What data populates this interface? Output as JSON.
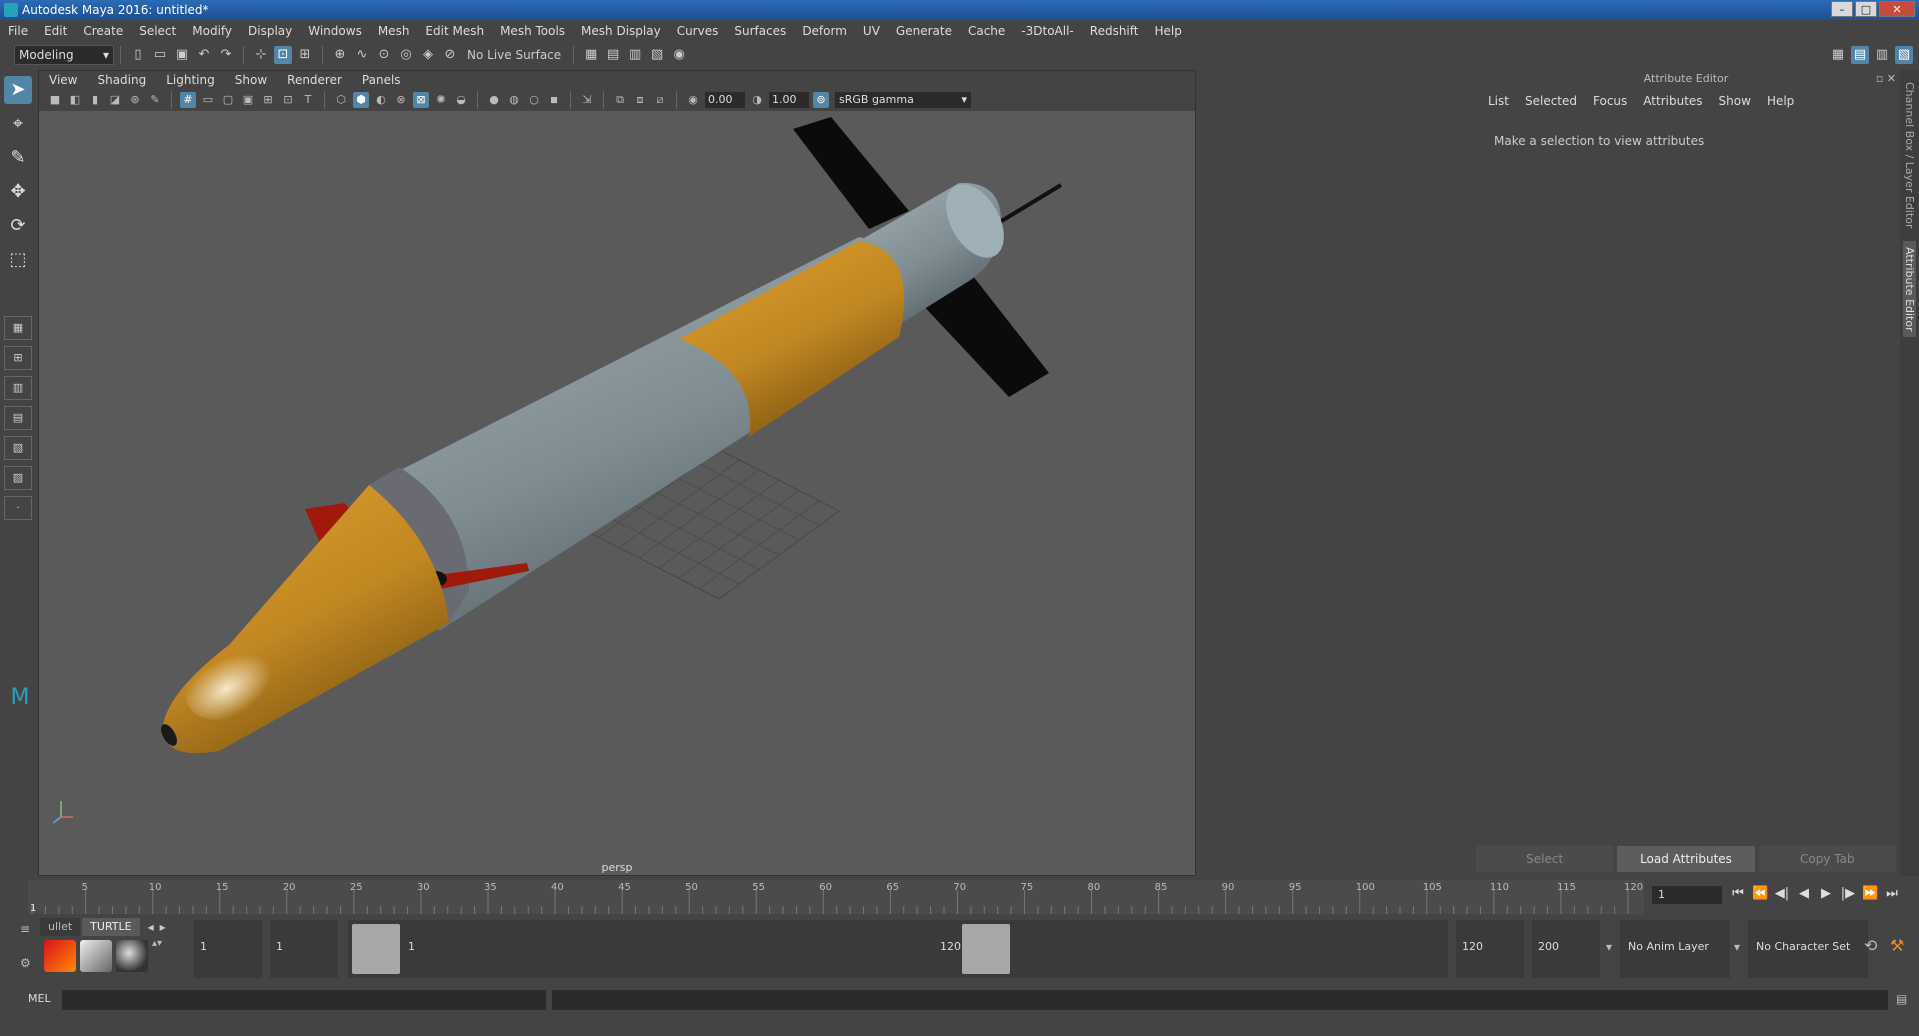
{
  "window": {
    "title": "Autodesk Maya 2016: untitled*"
  },
  "menus": [
    "File",
    "Edit",
    "Create",
    "Select",
    "Modify",
    "Display",
    "Windows",
    "Mesh",
    "Edit Mesh",
    "Mesh Tools",
    "Mesh Display",
    "Curves",
    "Surfaces",
    "Deform",
    "UV",
    "Generate",
    "Cache",
    "-3DtoAll-",
    "Redshift",
    "Help"
  ],
  "toolbar": {
    "menu_set": "Modeling",
    "live_surface": "No Live Surface"
  },
  "viewport": {
    "menus": [
      "View",
      "Shading",
      "Lighting",
      "Show",
      "Renderer",
      "Panels"
    ],
    "exposure": "0.00",
    "gamma": "1.00",
    "color_space": "sRGB gamma",
    "camera": "persp"
  },
  "attribute_editor": {
    "title": "Attribute Editor",
    "menus": [
      "List",
      "Selected",
      "Focus",
      "Attributes",
      "Show",
      "Help"
    ],
    "message": "Make a selection to view attributes",
    "buttons": {
      "select": "Select",
      "load": "Load Attributes",
      "copy": "Copy Tab"
    }
  },
  "side_tabs": [
    "Channel Box / Layer Editor",
    "Attribute Editor"
  ],
  "timeline": {
    "ticks": [
      "5",
      "10",
      "15",
      "20",
      "25",
      "30",
      "35",
      "40",
      "45",
      "50",
      "55",
      "60",
      "65",
      "70",
      "75",
      "80",
      "85",
      "90",
      "95",
      "100",
      "105",
      "110",
      "115",
      "120"
    ],
    "start_tick": "1",
    "current_frame": "1"
  },
  "range": {
    "start": "1",
    "playback_start": "1",
    "slider_start": "1",
    "slider_end": "120",
    "playback_end": "120",
    "end": "200",
    "anim_layer": "No Anim Layer",
    "character_set": "No Character Set"
  },
  "shelf": {
    "tabs": [
      "ullet",
      "TURTLE"
    ]
  },
  "command": {
    "label": "MEL"
  }
}
